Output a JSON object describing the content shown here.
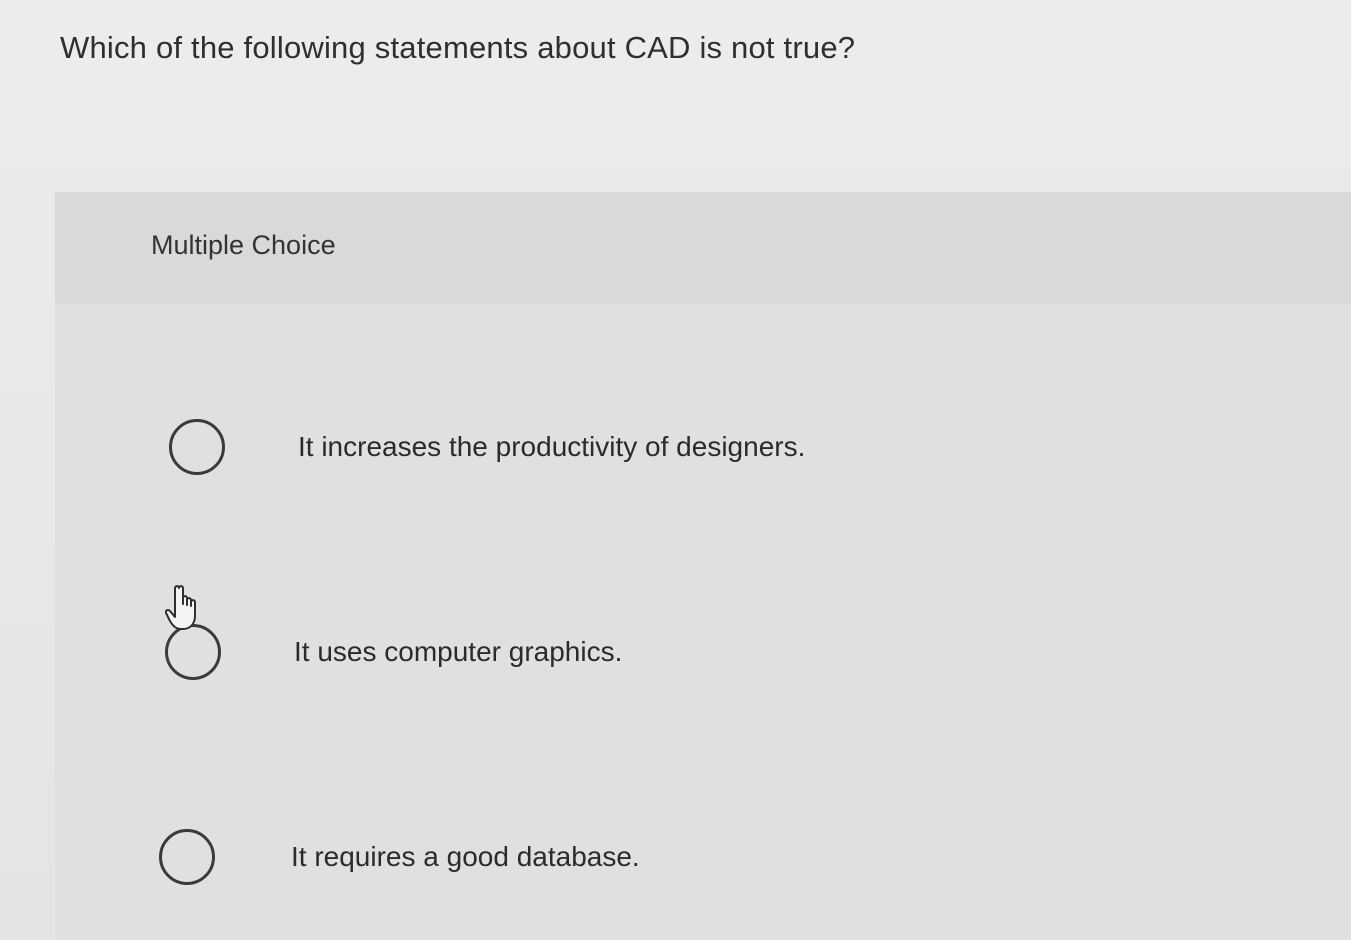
{
  "question": {
    "text": "Which of the following statements about CAD is not true?"
  },
  "multiple_choice": {
    "label": "Multiple Choice",
    "options": [
      {
        "text": "It increases the productivity of designers.",
        "selected": false
      },
      {
        "text": "It uses computer graphics.",
        "selected": false
      },
      {
        "text": "It requires a good database.",
        "selected": false
      }
    ]
  },
  "cursor": {
    "icon": "hand-pointer-icon"
  }
}
